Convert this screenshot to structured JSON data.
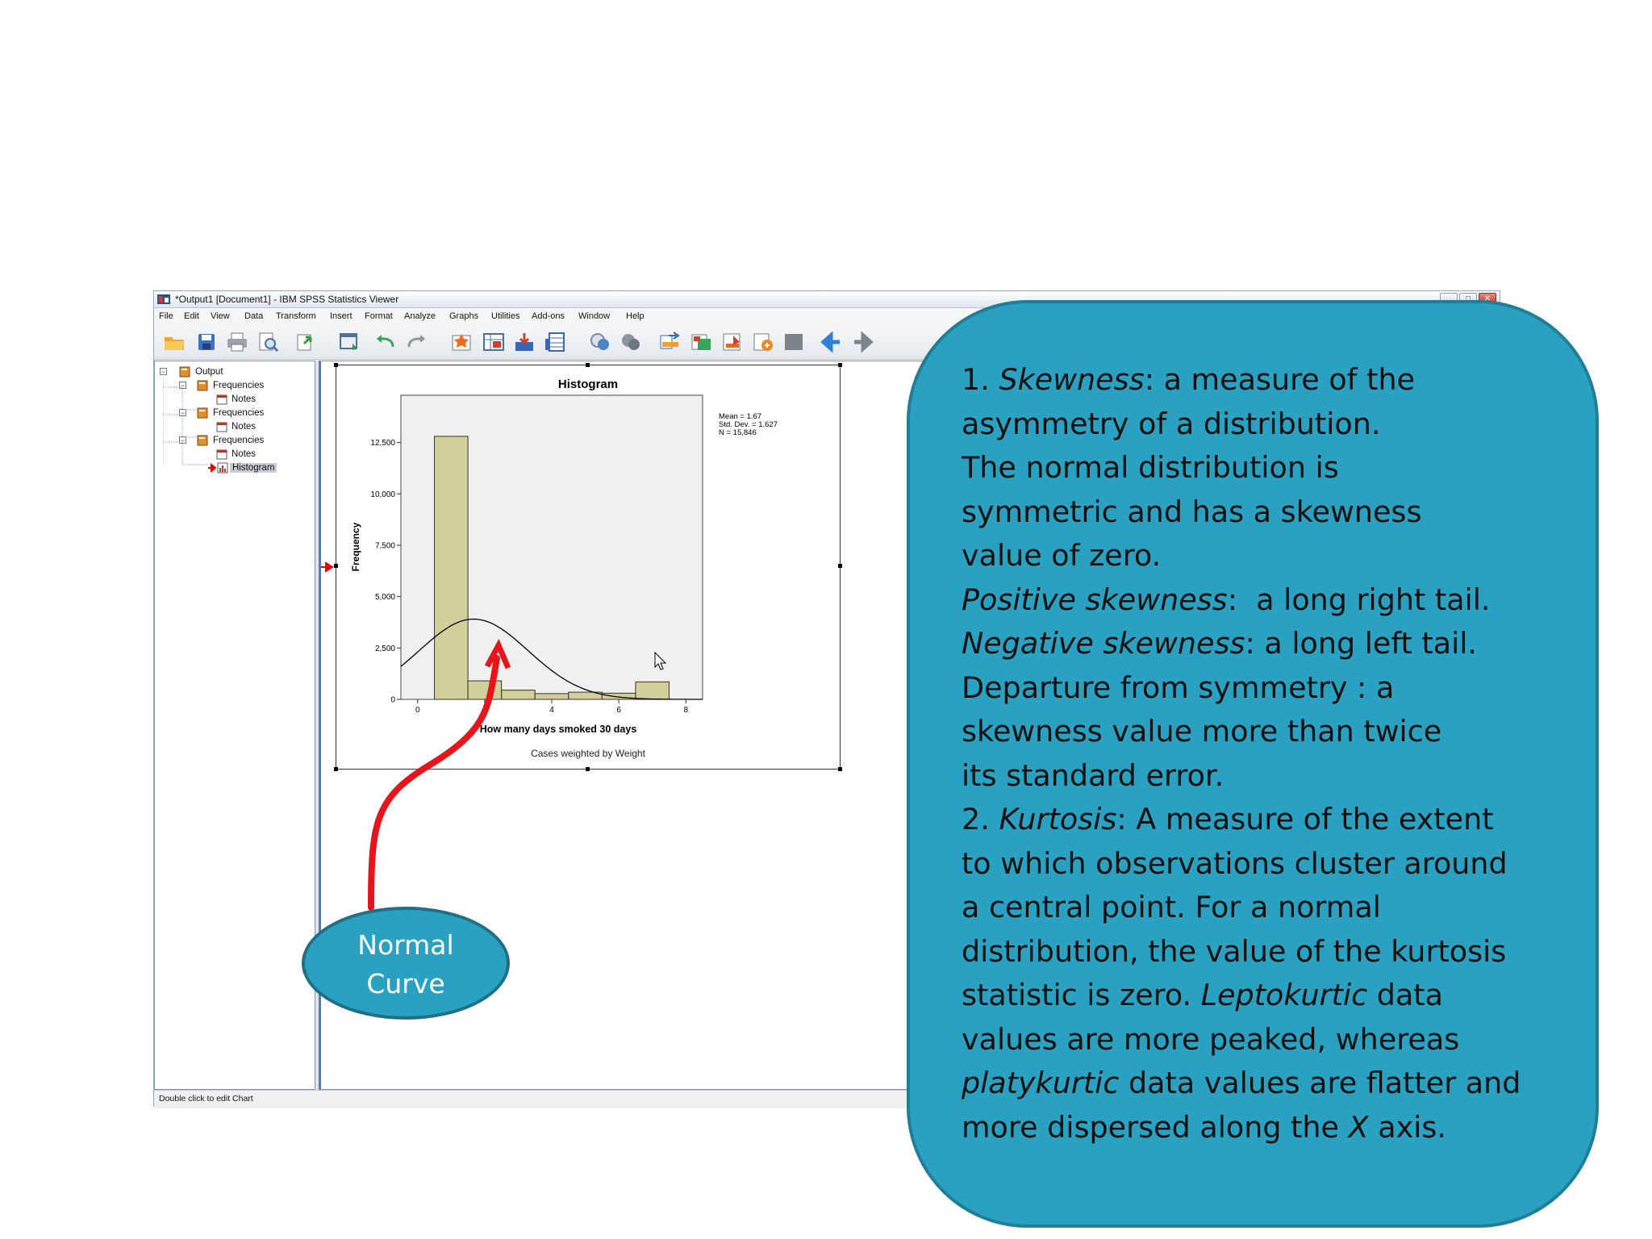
{
  "window": {
    "title": "*Output1 [Document1] - IBM SPSS Statistics Viewer",
    "controls": [
      "_",
      "□",
      "✕"
    ]
  },
  "menu": [
    "File",
    "Edit",
    "View",
    "Data",
    "Transform",
    "Insert",
    "Format",
    "Analyze",
    "Graphs",
    "Utilities",
    "Add-ons",
    "Window",
    "Help"
  ],
  "toolbar_icons": [
    "open-icon",
    "save-icon",
    "print-icon",
    "print-preview-icon",
    "export-icon",
    "recall-dialog-icon",
    "undo-icon",
    "redo-icon",
    "goto-case-icon",
    "goto-variable-icon",
    "variables-icon",
    "data-editor-icon",
    "show-all-icon",
    "hide-icon",
    "pivot-icon",
    "designate-window-icon",
    "insert-heading-icon",
    "insert-title-icon",
    "insert-text-icon",
    "insert-chart-icon",
    "back-icon",
    "forward-icon"
  ],
  "tree": {
    "items": [
      {
        "label": "Output"
      },
      {
        "label": "Frequencies"
      },
      {
        "label": "Notes"
      },
      {
        "label": "Frequencies"
      },
      {
        "label": "Notes"
      },
      {
        "label": "Frequencies"
      },
      {
        "label": "Notes"
      },
      {
        "label": "Histogram"
      }
    ]
  },
  "status_bar": "Double click to edit Chart",
  "chart_data": {
    "type": "bar",
    "title": "Histogram",
    "xlabel": "How many days smoked 30 days",
    "ylabel": "Frequency",
    "footnote": "Cases weighted by Weight",
    "stats": [
      "Mean = 1.67",
      "Std. Dev. = 1.627",
      "N = 15,846"
    ],
    "bins": [
      [
        0.5,
        1.5
      ],
      [
        1.5,
        2.5
      ],
      [
        2.5,
        3.5
      ],
      [
        3.5,
        4.5
      ],
      [
        4.5,
        5.5
      ],
      [
        5.5,
        6.5
      ],
      [
        6.5,
        7.5
      ]
    ],
    "values": [
      12800,
      900,
      450,
      280,
      350,
      300,
      850
    ],
    "xlim": [
      -0.5,
      8.5
    ],
    "ylim": [
      0,
      14800
    ],
    "xticks": [
      0,
      2,
      4,
      6,
      8
    ],
    "yticks": [
      0,
      2500,
      5000,
      7500,
      10000,
      12500
    ],
    "ytick_labels": [
      "0",
      "2,500",
      "5,000",
      "7,500",
      "10,000",
      "12,500"
    ],
    "normal_curve": {
      "mean": 1.67,
      "sd": 1.627
    },
    "colors": {
      "bar": "#d1cf9a",
      "plot_bg": "#f0f0f0",
      "curve": "#000000"
    }
  },
  "callout": {
    "l1": {
      "num": "1. ",
      "term": "Skewness",
      "rest": ": a measure of the"
    },
    "l2": "asymmetry of a distribution.",
    "l3": "The normal distribution is",
    "l4": "symmetric and has a skewness",
    "l5": "value of zero.",
    "l6": {
      "term": "Positive skewness",
      "rest": ":  a long right tail."
    },
    "l7": {
      "term": "Negative skewness",
      "rest": ": a long left tail."
    },
    "l8": "Departure from symmetry : a",
    "l9": "skewness value more than twice",
    "l10": "its standard error.",
    "l11": {
      "num": "2. ",
      "term": "Kurtosis",
      "rest": ": A measure of the extent"
    },
    "l12": "to which observations cluster around",
    "l13": "a central point. For a normal",
    "l14": "distribution, the value of the kurtosis",
    "l15": {
      "pre": "statistic is zero. ",
      "term": "Leptokurtic",
      "rest": " data"
    },
    "l16": "values are more peaked, whereas",
    "l17": {
      "term": "platykurtic",
      "rest": " data values are flatter and"
    },
    "l18": {
      "pre": "more dispersed along the ",
      "term": "X",
      "rest": " axis."
    },
    "color": "#2aa1c0"
  },
  "annotation_bubble": {
    "line1": "Normal",
    "line2": "Curve",
    "color": "#2aa1c0",
    "arrow_color": "#e8141b"
  }
}
